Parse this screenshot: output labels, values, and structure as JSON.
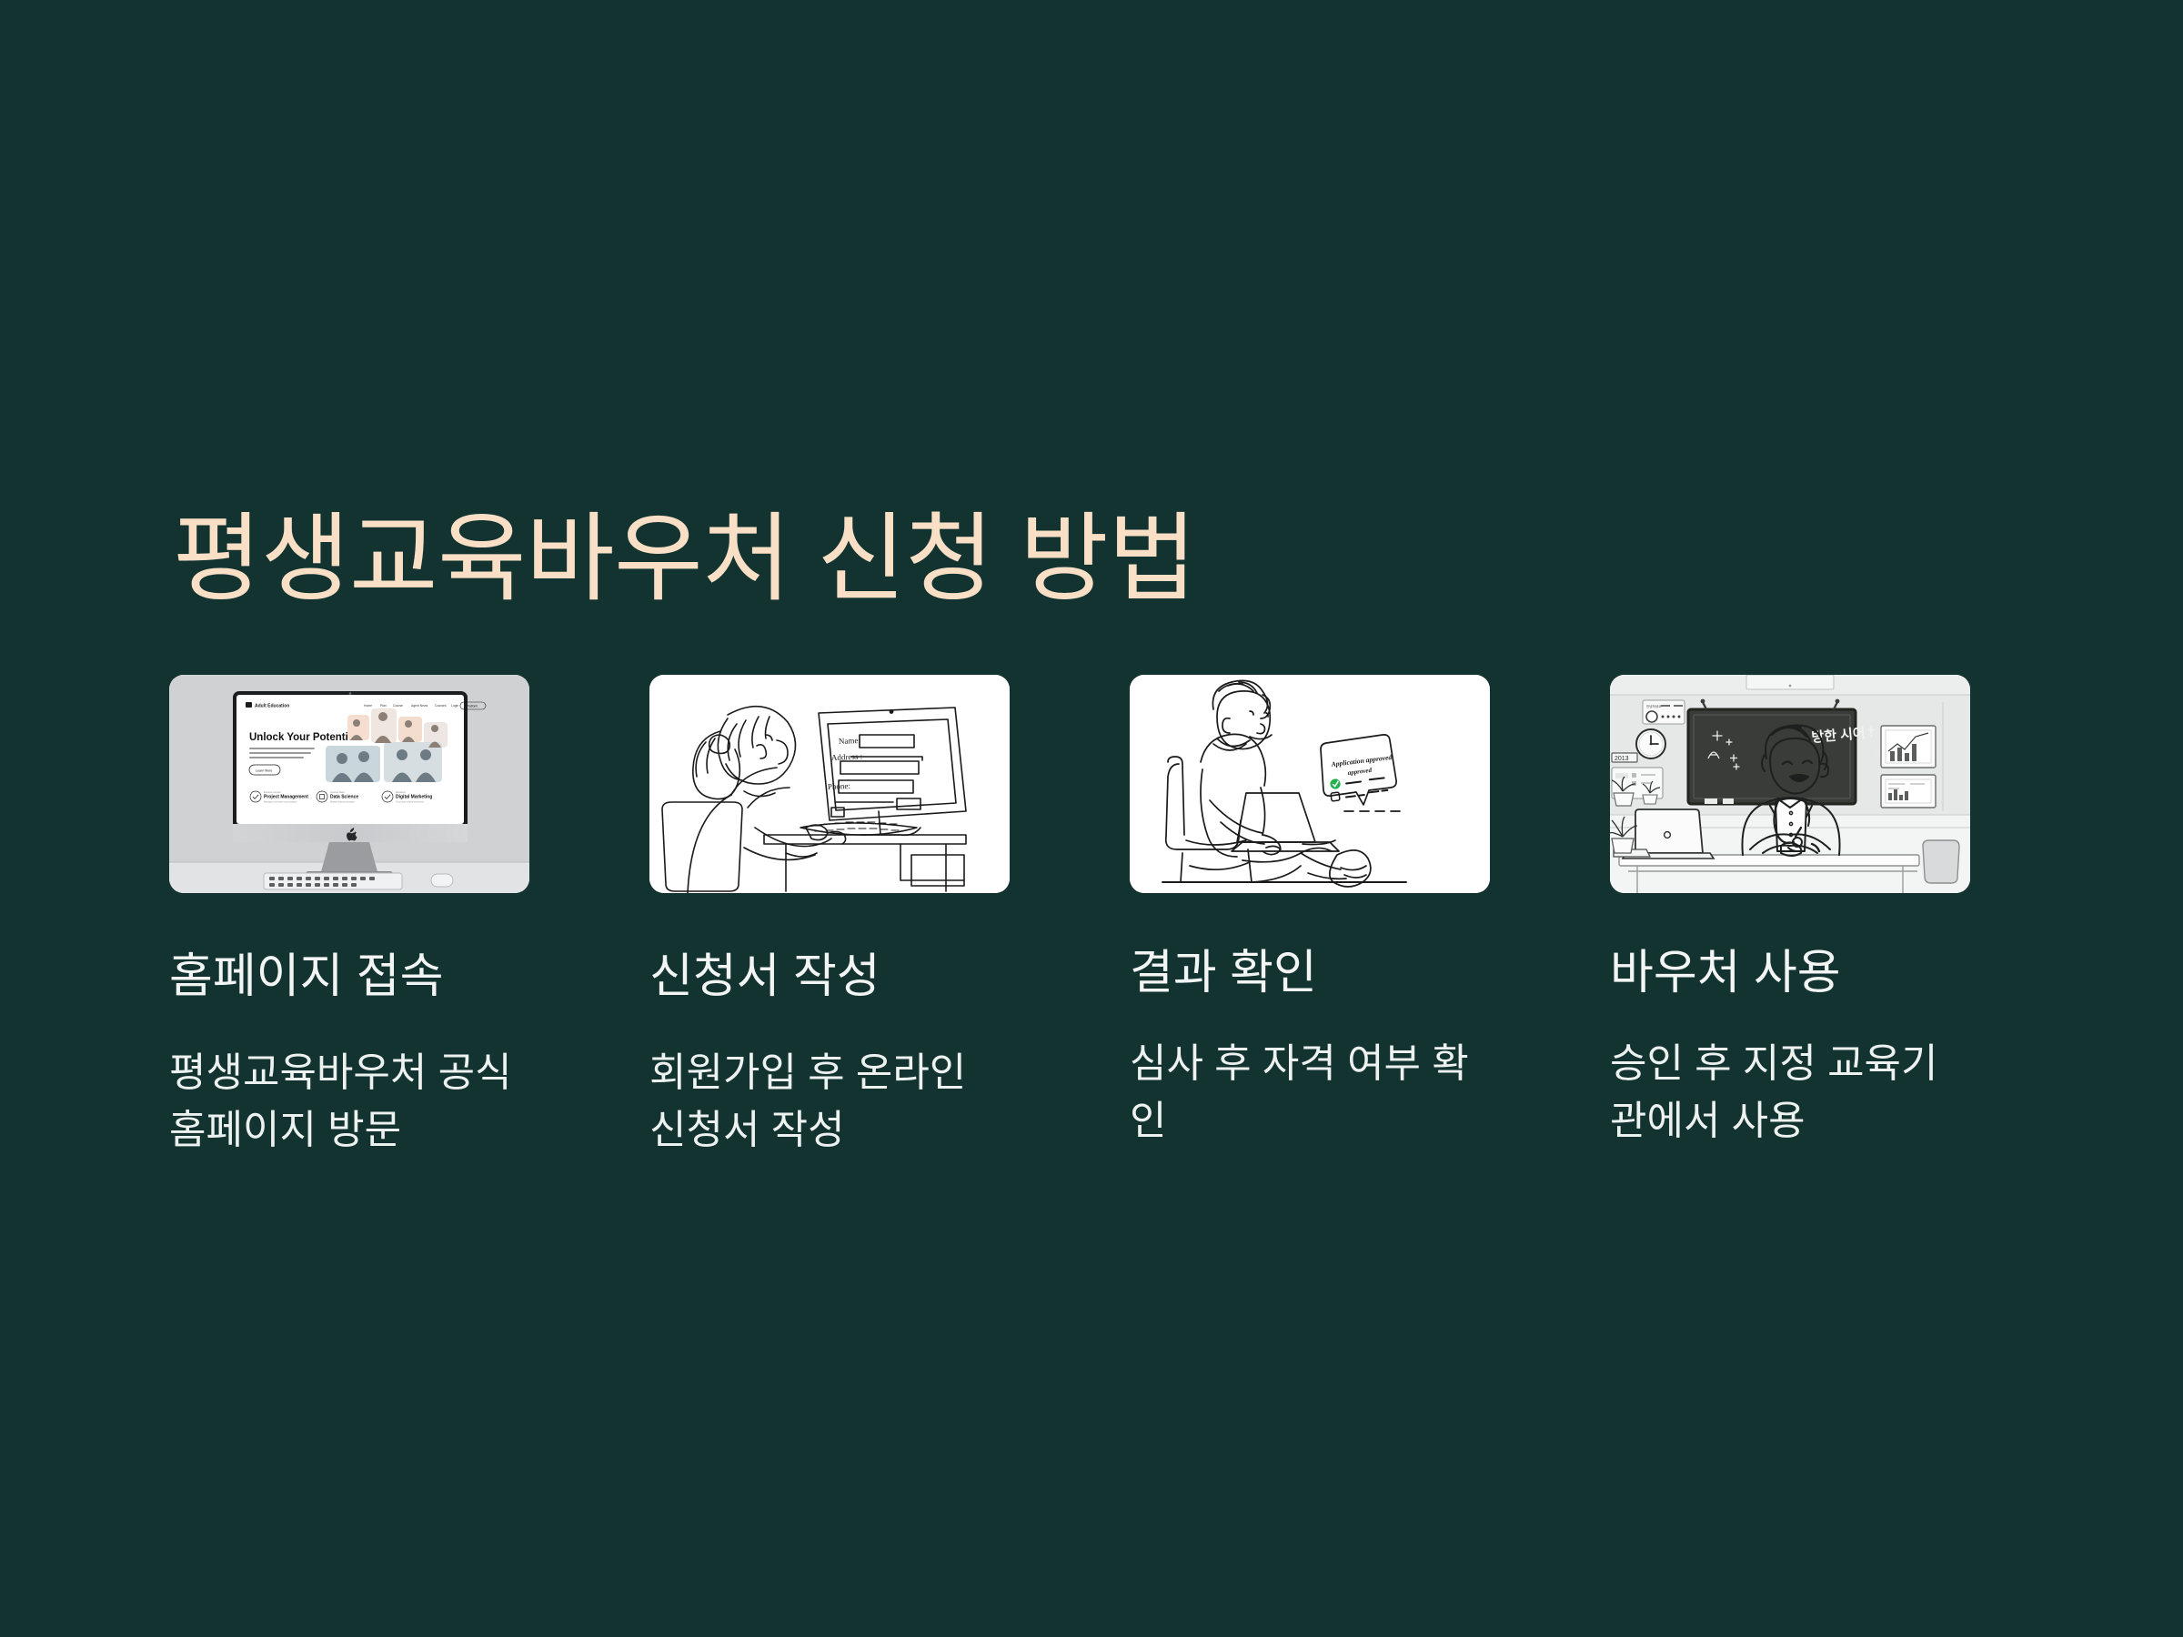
{
  "slide": {
    "title": "평생교육바우처 신청 방법",
    "background_color": "#123330",
    "title_color": "#F8DFC5",
    "text_color": "#F2F5F3"
  },
  "steps": [
    {
      "heading": "홈페이지 접속",
      "body": "평생교육바우처 공식 홈페이지 방문",
      "image": {
        "alt": "imac-desktop-showing-education-website",
        "site_logo": "Adult Education",
        "site_nav": [
          "Home",
          "Plan",
          "Course",
          "Agent News",
          "Courses",
          "Login"
        ],
        "site_cta": "Platform",
        "hero_heading": "Unlock Your Potential",
        "hero_button": "Learn More",
        "features": [
          {
            "eyebrow": "Explore courses",
            "title": "Project Management"
          },
          {
            "eyebrow": "Course Start",
            "title": "Data Science"
          },
          {
            "eyebrow": "Develop",
            "title": "Digital Marketing"
          }
        ]
      }
    },
    {
      "heading": "신청서 작성",
      "body": "회원가입 후 온라인 신청서 작성",
      "image": {
        "alt": "line-art-woman-filling-online-form-on-desktop",
        "form_fields": [
          "Name:",
          "Address :",
          "Phone:"
        ]
      }
    },
    {
      "heading": "결과 확인",
      "body": "심사 후 자격 여부 확인",
      "image": {
        "alt": "line-art-man-with-laptop-seeing-approval-notification",
        "notification_title": "Application approved",
        "notification_subtitle": "approved",
        "status_color": "#22b14c"
      }
    },
    {
      "heading": "바우처 사용",
      "body": "승인 후 지정 교육기관에서 사용",
      "image": {
        "alt": "line-art-classroom-with-teacher-at-desk-and-chalkboard",
        "chalkboard_text": "방한 시어 !",
        "shelf_label": "2013"
      }
    }
  ]
}
